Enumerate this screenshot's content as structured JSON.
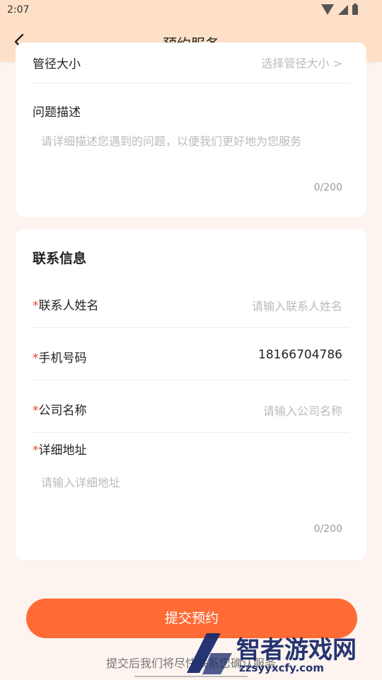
{
  "status": {
    "time": "2:07"
  },
  "header": {
    "title": "预约服务"
  },
  "form": {
    "cut_row": {
      "label": "管径大小",
      "placeholder": "选择管径大小 >"
    },
    "problem": {
      "label": "问题描述",
      "placeholder": "请详细描述您遇到的问题，以便我们更好地为您服务",
      "counter": "0/200"
    },
    "contact": {
      "title": "联系信息",
      "required_mark": "*",
      "name": {
        "label": "联系人姓名",
        "placeholder": "请输入联系人姓名"
      },
      "phone": {
        "label": "手机号码",
        "value": "18166704786"
      },
      "company": {
        "label": "公司名称",
        "placeholder": "请输入公司名称"
      },
      "address": {
        "label": "详细地址",
        "placeholder": "请输入详细地址",
        "counter": "0/200"
      }
    }
  },
  "submit": {
    "label": "提交预约"
  },
  "footnote": "提交后我们将尽快联系您确认服务",
  "watermark": {
    "text": "智者游戏网",
    "sub": "zzsyyxcfy.com"
  },
  "colors": {
    "accent": "#ff6b35",
    "header_bg": "#fde0c7",
    "required": "#e5483a"
  }
}
